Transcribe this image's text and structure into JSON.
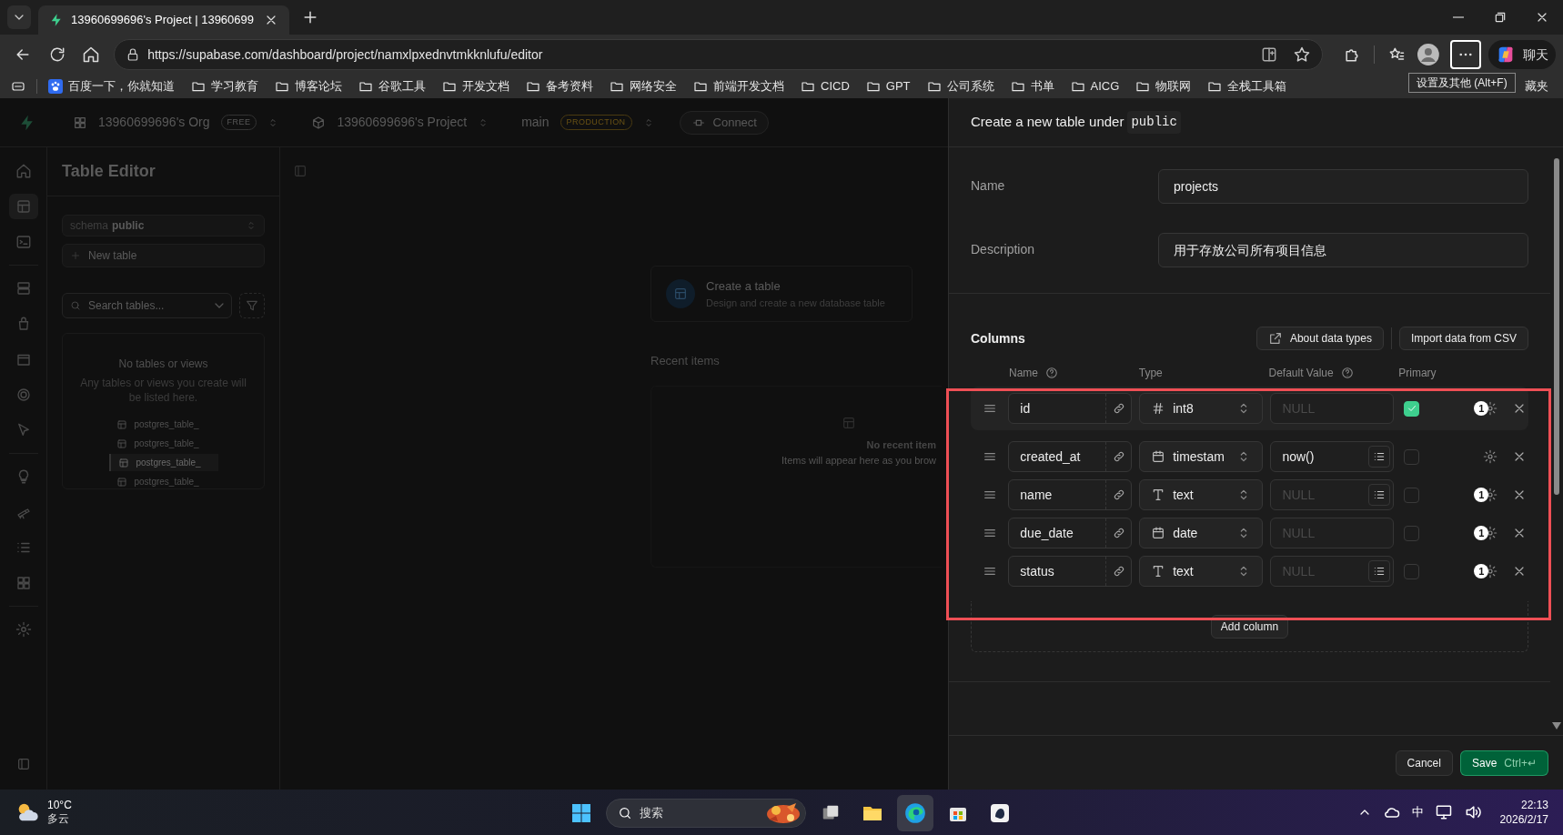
{
  "browser": {
    "tabs": [
      {
        "title": "13960699696's Project | 13960699",
        "selected": true
      }
    ],
    "url": "https://supabase.com/dashboard/project/namxlpxednvtmkknlufu/editor",
    "bookmarks": [
      "百度一下，你就知道",
      "学习教育",
      "博客论坛",
      "谷歌工具",
      "开发文档",
      "备考资料",
      "网络安全",
      "前端开发文档",
      "CICD",
      "GPT",
      "公司系统",
      "书单",
      "AICG",
      "物联网",
      "全栈工具箱"
    ],
    "bookmark_partial": "藏夹",
    "tooltip": "设置及其他 (Alt+F)",
    "chat_button": "聊天"
  },
  "dashboard": {
    "org": "13960699696's Org",
    "org_badge": "FREE",
    "project": "13960699696's Project",
    "branch": "main",
    "branch_badge": "PRODUCTION",
    "connect": "Connect",
    "sidebar_title": "Table Editor",
    "schema_label": "schema",
    "schema": "public",
    "new_table": "New table",
    "search_placeholder": "Search tables...",
    "empty_title": "No tables or views",
    "empty_text": "Any tables or views you create will be listed here.",
    "ghost_tables": [
      {
        "name": "postgres_table_",
        "selected": false
      },
      {
        "name": "postgres_table_",
        "selected": false
      },
      {
        "name": "postgres_table_",
        "selected": true
      },
      {
        "name": "postgres_table_",
        "selected": false
      }
    ],
    "create_title": "Create a table",
    "create_subtitle": "Design and create a new database table",
    "recent_title": "Recent items",
    "recent_empty_title": "No recent item",
    "recent_empty_text": "Items will appear here as you brow"
  },
  "panel": {
    "title": "Create a new table under",
    "schema": "public",
    "fields": [
      {
        "label": "Name",
        "value": "projects"
      },
      {
        "label": "Description",
        "value": "用于存放公司所有项目信息"
      }
    ],
    "columns_title": "Columns",
    "about_button": "About data types",
    "import_button": "Import data from CSV",
    "headers": [
      {
        "label": "Name",
        "help": true
      },
      {
        "label": "Type",
        "help": false
      },
      {
        "label": "Default Value",
        "help": true
      },
      {
        "label": "Primary",
        "help": false
      }
    ],
    "columns": [
      {
        "name": "id",
        "type": "int8",
        "kind": "number",
        "default_placeholder": "NULL",
        "default_menu": false,
        "primary": true,
        "badge": "1",
        "highlighted": true
      },
      {
        "name": "created_at",
        "type": "timestam",
        "kind": "date",
        "default": "now()",
        "default_menu": true,
        "primary": false,
        "highlighted": false
      },
      {
        "name": "name",
        "type": "text",
        "kind": "string",
        "default_placeholder": "NULL",
        "default_menu": true,
        "primary": false,
        "badge": "1",
        "highlighted": false
      },
      {
        "name": "due_date",
        "type": "date",
        "kind": "date",
        "default_placeholder": "NULL",
        "default_menu": false,
        "primary": false,
        "badge": "1",
        "highlighted": false
      },
      {
        "name": "status",
        "type": "text",
        "kind": "string",
        "default_placeholder": "NULL",
        "default_menu": true,
        "primary": false,
        "badge": "1",
        "highlighted": false
      }
    ],
    "add_column": "Add column",
    "cancel": "Cancel",
    "save": "Save",
    "save_shortcut": "Ctrl+↵"
  },
  "taskbar": {
    "temperature": "10°C",
    "weather": "多云",
    "search": "搜索",
    "ime": "中",
    "time": "22:13",
    "date": "2026/2/17"
  }
}
